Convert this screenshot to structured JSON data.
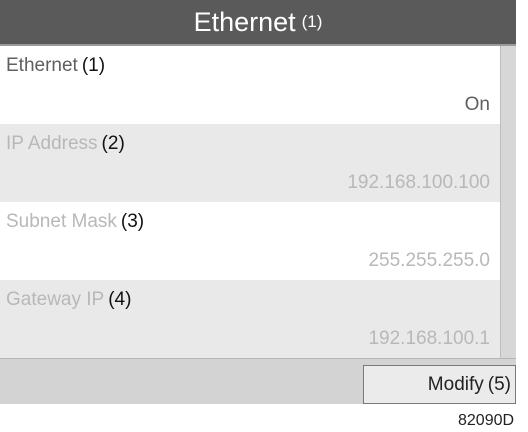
{
  "header": {
    "title": "Ethernet",
    "callout": "(1)"
  },
  "fields": [
    {
      "label": "Ethernet",
      "callout": "(1)",
      "value": "On"
    },
    {
      "label": "IP Address",
      "callout": "(2)",
      "value": "192.168.100.100"
    },
    {
      "label": "Subnet Mask",
      "callout": "(3)",
      "value": "255.255.255.0"
    },
    {
      "label": "Gateway IP",
      "callout": "(4)",
      "value": "192.168.100.1"
    }
  ],
  "footer": {
    "modify_label": "Modify",
    "modify_callout": "(5)"
  },
  "figure_code": "82090D"
}
